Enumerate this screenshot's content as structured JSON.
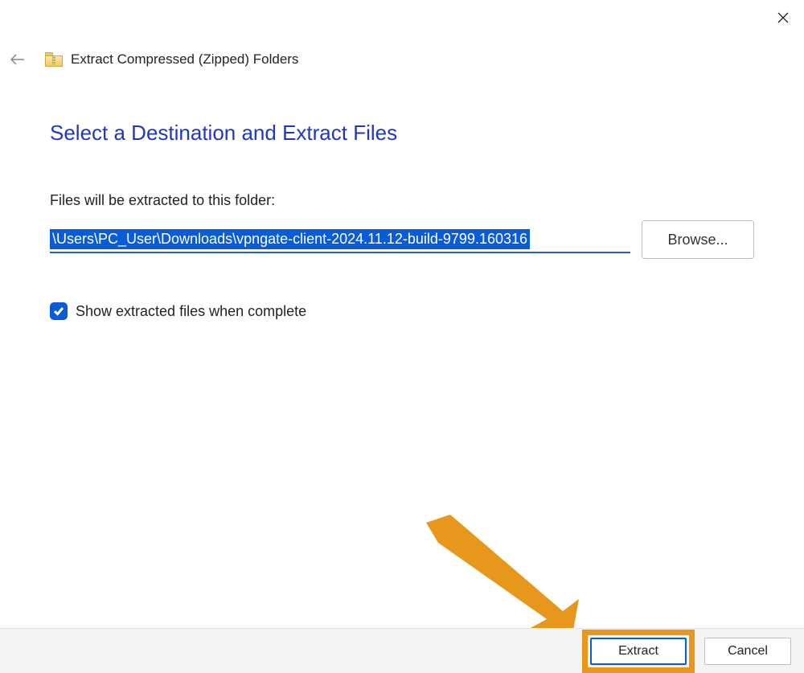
{
  "header": {
    "title": "Extract Compressed (Zipped) Folders"
  },
  "content": {
    "heading": "Select a Destination and Extract Files",
    "label": "Files will be extracted to this folder:",
    "path_value": "\\Users\\PC_User\\Downloads\\vpngate-client-2024.11.12-build-9799.160316",
    "browse_label": "Browse...",
    "show_files_label": "Show extracted files when complete",
    "show_files_checked": true
  },
  "footer": {
    "extract_label": "Extract",
    "cancel_label": "Cancel"
  }
}
